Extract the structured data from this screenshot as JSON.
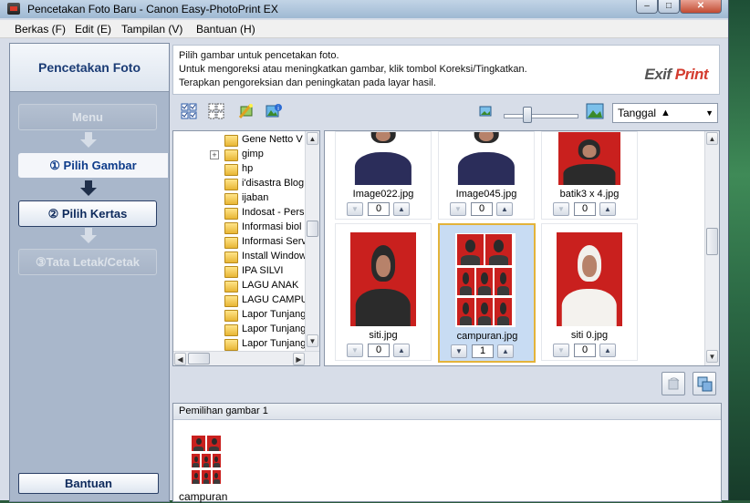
{
  "window": {
    "title": "Pencetakan Foto Baru - Canon Easy-PhotoPrint EX"
  },
  "menubar": [
    "Berkas (F)",
    "Edit (E)",
    "Tampilan (V)",
    "Bantuan (H)"
  ],
  "sidebar": {
    "title": "Pencetakan Foto",
    "menu_label": "Menu",
    "steps": [
      {
        "label": "① Pilih Gambar",
        "state": "active"
      },
      {
        "label": "② Pilih Kertas",
        "state": "enabled"
      },
      {
        "label": "③Tata Letak/Cetak",
        "state": "disabled"
      }
    ],
    "help_label": "Bantuan"
  },
  "instructions": {
    "line1": "Pilih gambar untuk pencetakan foto.",
    "line2": "Untuk mengoreksi atau meningkatkan gambar, klik tombol Koreksi/Tingkatkan.",
    "line3": "Terapkan pengoreksian dan peningkatan pada layar hasil.",
    "logo_a": "Exif ",
    "logo_b": "Print"
  },
  "toolbar": {
    "sort_value": "Tanggal",
    "sort_arrow": "▲",
    "icons": [
      "select-all-icon",
      "deselect-all-icon",
      "correct-enhance-icon",
      "image-info-icon"
    ],
    "zoom": {
      "level": 0.4
    }
  },
  "tree": {
    "folders": [
      {
        "name": "Gene Netto  V",
        "expandable": false
      },
      {
        "name": "gimp",
        "expandable": true
      },
      {
        "name": "hp",
        "expandable": false
      },
      {
        "name": "i'disastra Blog",
        "expandable": false
      },
      {
        "name": "ijaban",
        "expandable": false
      },
      {
        "name": "Indosat - Pers",
        "expandable": false
      },
      {
        "name": "Informasi biol",
        "expandable": false
      },
      {
        "name": "Informasi Serv",
        "expandable": false
      },
      {
        "name": "Install Window",
        "expandable": false
      },
      {
        "name": "IPA SILVI",
        "expandable": false
      },
      {
        "name": "LAGU ANAK",
        "expandable": false
      },
      {
        "name": "LAGU CAMPUR",
        "expandable": false
      },
      {
        "name": "Lapor Tunjang",
        "expandable": false
      },
      {
        "name": "Lapor Tunjang",
        "expandable": false
      },
      {
        "name": "Lapor Tunjang",
        "expandable": false
      }
    ]
  },
  "thumbnails": [
    {
      "name": "Image022.jpg",
      "count": "0",
      "selected": false,
      "style": "crop"
    },
    {
      "name": "Image045.jpg",
      "count": "0",
      "selected": false,
      "style": "crop"
    },
    {
      "name": "batik3 x 4.jpg",
      "count": "0",
      "selected": false,
      "style": "dark"
    },
    {
      "name": "siti.jpg",
      "count": "0",
      "selected": false,
      "style": "dark"
    },
    {
      "name": "campuran.jpg",
      "count": "1",
      "selected": true,
      "style": "collage"
    },
    {
      "name": "siti 0.jpg",
      "count": "0",
      "selected": false,
      "style": "light"
    }
  ],
  "selection_panel": {
    "header": "Pemilihan gambar 1",
    "items": [
      {
        "label": "campuran"
      }
    ]
  }
}
